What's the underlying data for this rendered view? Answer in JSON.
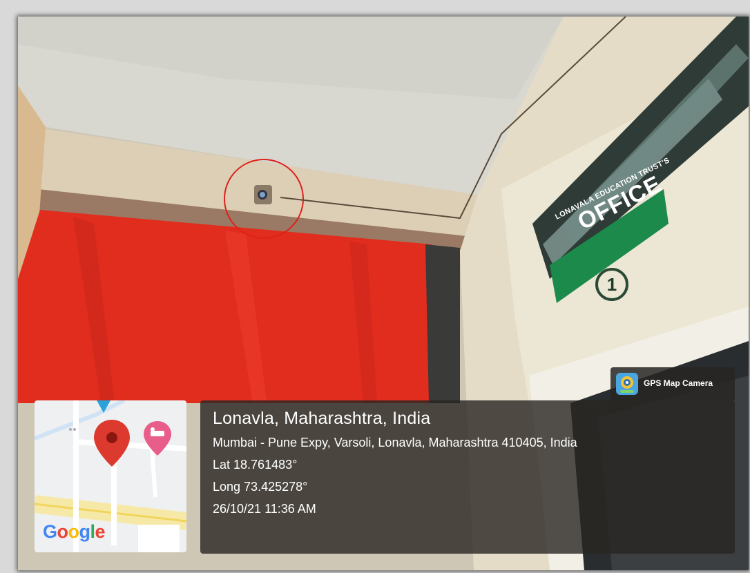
{
  "photo": {
    "objects": [
      "ceiling",
      "cctv-camera",
      "red-tarpaulin",
      "office-sign",
      "room-number-sign",
      "window",
      "door"
    ]
  },
  "sign": {
    "line1": "LONAVALA EDUCATION TRUST'S",
    "line2": "OFFICE",
    "number": "1"
  },
  "app_badge": {
    "label": "GPS Map Camera",
    "icon": "gps-map-camera-icon"
  },
  "location": {
    "title": "Lonavla, Maharashtra, India",
    "address": "Mumbai - Pune Expy, Varsoli, Lonavla, Maharashtra 410405, India",
    "lat": "Lat 18.761483°",
    "long": "Long 73.425278°",
    "datetime": "26/10/21 11:36 AM"
  },
  "map": {
    "provider": "Google",
    "marker_color": "#dd3a2f",
    "poi_color": "#e85d89"
  },
  "highlight": {
    "color": "#e0201a"
  }
}
